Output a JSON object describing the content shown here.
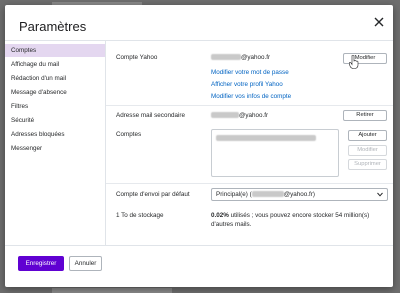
{
  "dialog": {
    "title": "Paramètres"
  },
  "sidebar": {
    "items": [
      {
        "label": "Comptes",
        "selected": true
      },
      {
        "label": "Affichage du mail"
      },
      {
        "label": "Rédaction d'un mail"
      },
      {
        "label": "Message d'absence"
      },
      {
        "label": "Filtres"
      },
      {
        "label": "Sécurité"
      },
      {
        "label": "Adresses bloquées"
      },
      {
        "label": "Messenger"
      }
    ]
  },
  "accounts": {
    "yahoo_label": "Compte Yahoo",
    "yahoo_email_suffix": "@yahoo.fr",
    "modify_button": "Modifier",
    "links": [
      "Modifier votre mot de passe",
      "Afficher votre profil Yahoo",
      "Modifier vos infos de compte"
    ],
    "secondary_label": "Adresse mail secondaire",
    "secondary_email_suffix": "@yahoo.fr",
    "remove_button": "Retirer",
    "accounts_label": "Comptes",
    "add_button": "Ajouter",
    "list_modify_button": "Modifier",
    "delete_button": "Supprimer",
    "default_send_label": "Compte d'envoi par défaut",
    "default_send_prefix": "Principal(e) (",
    "default_send_suffix": "@yahoo.fr)",
    "storage_label": "1 To de stockage",
    "storage_percent": "0.02%",
    "storage_text": " utilisés ; vous pouvez encore stocker 54 million(s) d'autres mails."
  },
  "footer": {
    "save_button": "Enregistrer",
    "cancel_button": "Annuler"
  },
  "colors": {
    "accent": "#6001d2",
    "link": "#0063c2",
    "selected_nav": "#e4d7f0"
  }
}
